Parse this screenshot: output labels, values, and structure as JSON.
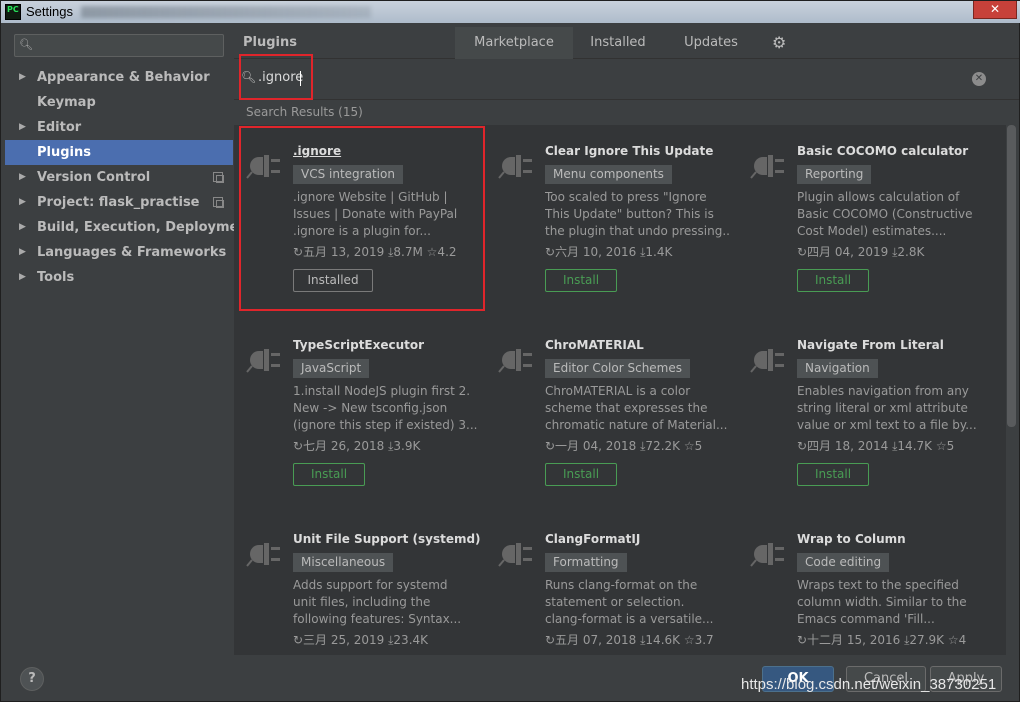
{
  "window": {
    "title": "Settings",
    "logo": "PC",
    "close_icon": "✕"
  },
  "sidebar": {
    "search_placeholder": "",
    "items": [
      {
        "label": "Appearance & Behavior",
        "arrow": "▶"
      },
      {
        "label": "Keymap",
        "arrow": ""
      },
      {
        "label": "Editor",
        "arrow": "▶"
      },
      {
        "label": "Plugins",
        "arrow": ""
      },
      {
        "label": "Version Control",
        "arrow": "▶"
      },
      {
        "label": "Project: flask_practise",
        "arrow": "▶"
      },
      {
        "label": "Build, Execution, Deployment",
        "arrow": "▶"
      },
      {
        "label": "Languages & Frameworks",
        "arrow": "▶"
      },
      {
        "label": "Tools",
        "arrow": "▶"
      }
    ]
  },
  "header": {
    "title": "Plugins",
    "tabs": [
      "Marketplace",
      "Installed",
      "Updates"
    ],
    "gear_icon": "⚙"
  },
  "search": {
    "query": ".ignore",
    "clear_icon": "✕"
  },
  "results": {
    "heading": "Search Results (15)"
  },
  "plugins": [
    {
      "name": ".ignore",
      "tag": "VCS integration",
      "desc": [
        ".ignore Website | GitHub |",
        "Issues | Donate with PayPal",
        ".ignore is a plugin for..."
      ],
      "meta": "↻五月 13, 2019  ⤓8.7M  ☆4.2",
      "button": "Installed"
    },
    {
      "name": "Clear Ignore This Update",
      "tag": "Menu components",
      "desc": [
        "Too scaled to press \"Ignore",
        "This Update\" button? This is",
        "the plugin that undo pressing..."
      ],
      "meta": "↻六月 10, 2016  ⤓1.4K",
      "button": "Install"
    },
    {
      "name": "Basic COCOMO calculator",
      "tag": "Reporting",
      "desc": [
        "Plugin allows calculation of",
        "Basic COCOMO (Constructive",
        "Cost Model) estimates...."
      ],
      "meta": "↻四月 04, 2019  ⤓2.8K",
      "button": "Install"
    },
    {
      "name": "TypeScriptExecutor",
      "tag": "JavaScript",
      "desc": [
        "1.install NodeJS plugin first 2.",
        "New -> New tsconfig.json",
        "(ignore this step if existed) 3...."
      ],
      "meta": "↻七月 26, 2018  ⤓3.9K",
      "button": "Install"
    },
    {
      "name": "ChroMATERIAL",
      "tag": "Editor Color Schemes",
      "desc": [
        "ChroMATERIAL is a color",
        "scheme that expresses the",
        "chromatic nature of Material..."
      ],
      "meta": "↻一月 04, 2018  ⤓72.2K  ☆5",
      "button": "Install"
    },
    {
      "name": "Navigate From Literal",
      "tag": "Navigation",
      "desc": [
        "Enables navigation from any",
        "string literal or xml attribute",
        "value or xml text to a file by..."
      ],
      "meta": "↻四月 18, 2014  ⤓14.7K  ☆5",
      "button": "Install"
    },
    {
      "name": "Unit File Support (systemd)",
      "tag": "Miscellaneous",
      "desc": [
        "Adds support for systemd",
        "unit files, including the",
        "following features: Syntax..."
      ],
      "meta": "↻三月 25, 2019  ⤓23.4K",
      "button": ""
    },
    {
      "name": "ClangFormatIJ",
      "tag": "Formatting",
      "desc": [
        "Runs clang-format on the",
        "statement or selection.",
        "clang-format is a versatile..."
      ],
      "meta": "↻五月 07, 2018  ⤓14.6K  ☆3.7",
      "button": ""
    },
    {
      "name": "Wrap to Column",
      "tag": "Code editing",
      "desc": [
        "Wraps text to the specified",
        "column width. Similar to the",
        "Emacs command 'Fill..."
      ],
      "meta": "↻十二月 15, 2016  ⤓27.9K  ☆4",
      "button": ""
    }
  ],
  "footer": {
    "help": "?",
    "ok": "OK",
    "cancel": "Cancel",
    "apply": "Apply"
  },
  "watermark": "https://blog.csdn.net/weixin_38730251",
  "colors": {
    "accent": "#4b6eaf",
    "install_green": "#499c54",
    "annotation_red": "#e0252b"
  }
}
